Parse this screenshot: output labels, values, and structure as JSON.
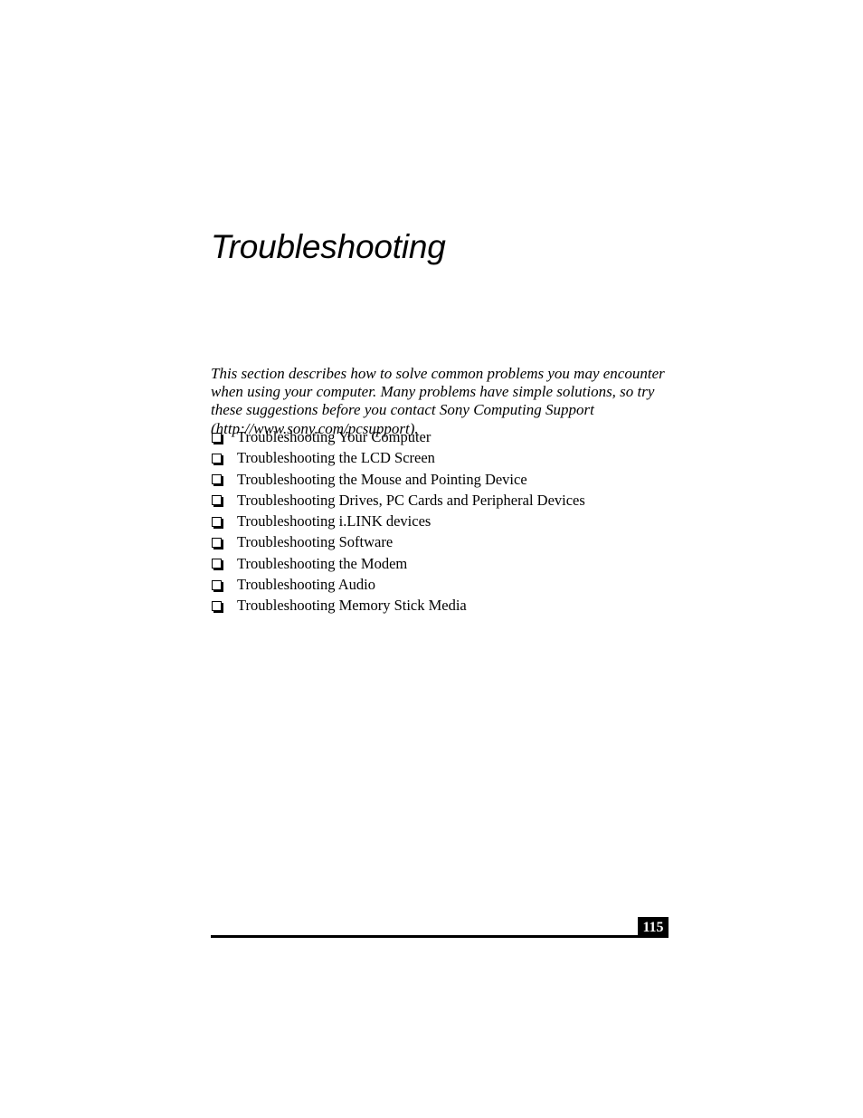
{
  "document": {
    "chapter_title": "Troubleshooting",
    "page_number": "115",
    "intro_paragraph": "This section describes how to solve common problems you may encounter when using your computer. Many problems have simple solutions, so try these suggestions before you contact Sony Computing Support (http://www.sony.com/pcsupport).",
    "bullet_glyph": "hollow-square-bullet-icon",
    "colors": {
      "text": "#000000",
      "page_background": "#ffffff",
      "page_number_box": "#000000",
      "page_number_text": "#ffffff",
      "footer_rule": "#000000"
    }
  },
  "sections": [
    {
      "label": "Troubleshooting Your Computer"
    },
    {
      "label": "Troubleshooting the LCD Screen"
    },
    {
      "label": "Troubleshooting the Mouse and Pointing Device"
    },
    {
      "label": "Troubleshooting Drives, PC Cards and Peripheral Devices"
    },
    {
      "label": "Troubleshooting i.LINK devices"
    },
    {
      "label": "Troubleshooting Software"
    },
    {
      "label": "Troubleshooting the Modem"
    },
    {
      "label": "Troubleshooting Audio"
    },
    {
      "label": "Troubleshooting Memory Stick Media"
    }
  ]
}
